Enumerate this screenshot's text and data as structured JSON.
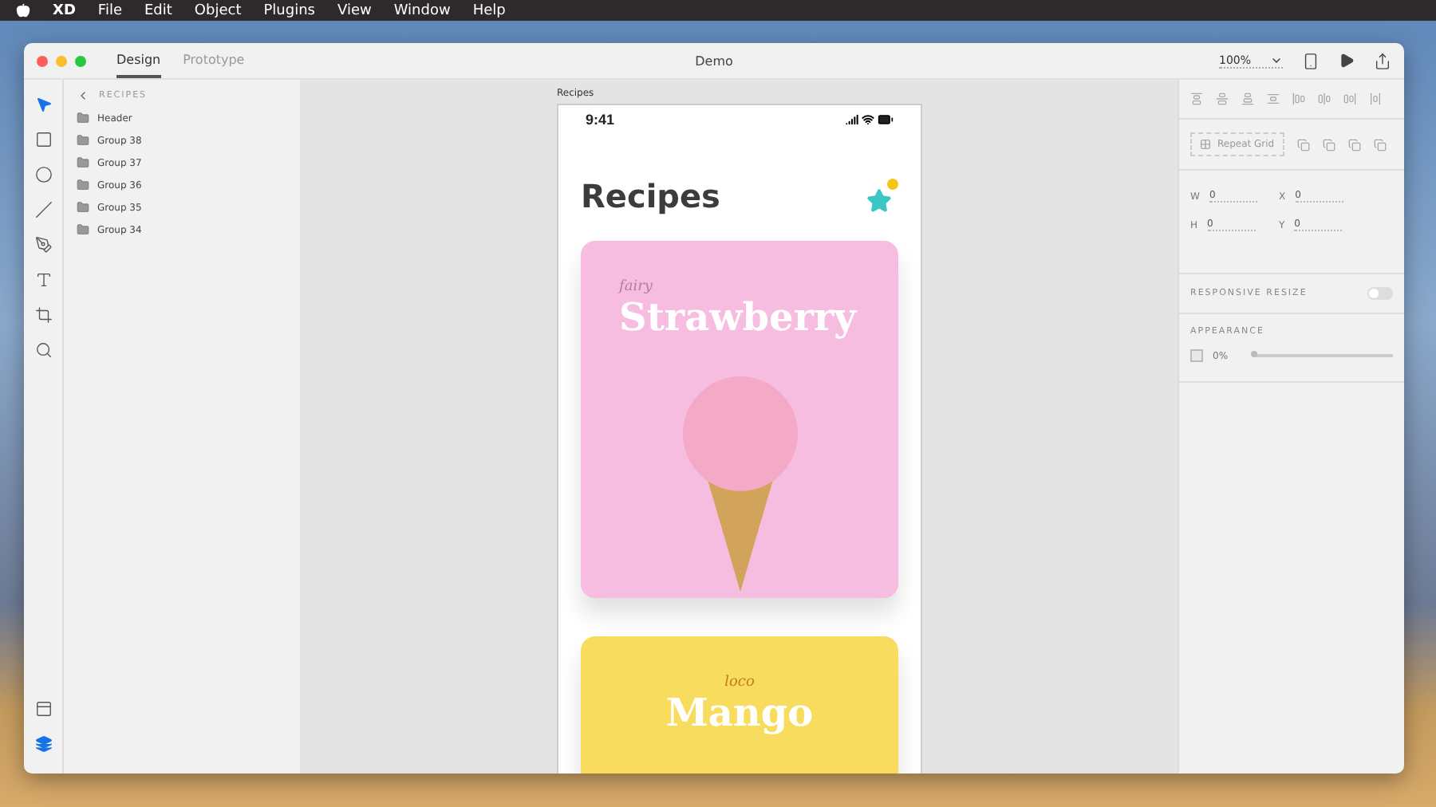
{
  "menu_bar": {
    "items": [
      "XD",
      "File",
      "Edit",
      "Object",
      "Plugins",
      "View",
      "Window",
      "Help"
    ]
  },
  "window": {
    "title": "Demo",
    "zoom": "100%"
  },
  "tabs": [
    {
      "label": "Design",
      "selected": true
    },
    {
      "label": "Prototype",
      "selected": false
    }
  ],
  "tools": [
    {
      "kind": "select",
      "selected": true
    },
    {
      "kind": "rectangle",
      "selected": false
    },
    {
      "kind": "ellipse",
      "selected": false
    },
    {
      "kind": "line",
      "selected": false
    },
    {
      "kind": "pen",
      "selected": false
    },
    {
      "kind": "text",
      "selected": false
    },
    {
      "kind": "artboard",
      "selected": false
    },
    {
      "kind": "zoom",
      "selected": false
    }
  ],
  "bottom_tools": [
    {
      "kind": "assets",
      "selected": false
    },
    {
      "kind": "layers",
      "selected": true
    }
  ],
  "layers": {
    "heading": "RECIPES",
    "items": [
      "Header",
      "Group 38",
      "Group 37",
      "Group 36",
      "Group 35",
      "Group 34"
    ]
  },
  "artboard": {
    "label": "Recipes",
    "time": "9:41",
    "title": "Recipes",
    "cards": [
      {
        "subtitle": "fairy",
        "title": "Strawberry",
        "color": "#f7bde0"
      },
      {
        "subtitle": "loco",
        "title": "Mango",
        "color": "#f8dc5e"
      }
    ]
  },
  "properties": {
    "repeat_grid": "Repeat Grid",
    "fields": [
      {
        "label": "W",
        "value": "0"
      },
      {
        "label": "X",
        "value": "0"
      },
      {
        "label": "H",
        "value": "0"
      },
      {
        "label": "Y",
        "value": "0"
      }
    ],
    "responsive_resize": {
      "label": "RESPONSIVE RESIZE",
      "on": false
    },
    "appearance": {
      "label": "APPEARANCE",
      "opacity": "0%",
      "checked": false,
      "level": 0
    }
  }
}
